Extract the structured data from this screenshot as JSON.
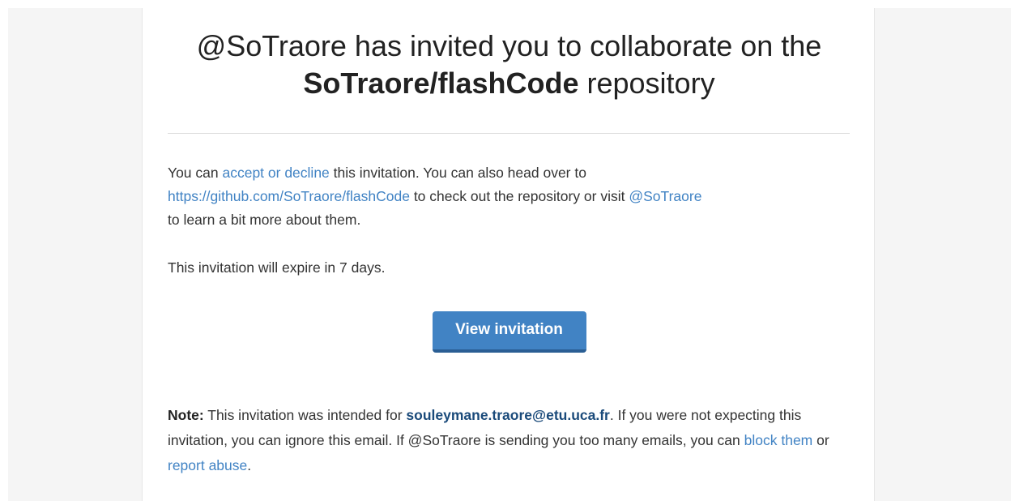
{
  "header": {
    "line1": "@SoTraore has invited you to collaborate on the",
    "repo": "SoTraore/flashCode",
    "repo_suffix": " repository"
  },
  "body": {
    "p1_before_accept": "You can ",
    "accept_link": "accept or decline",
    "p1_after_accept": " this invitation. You can also head over to",
    "repo_url": "https://github.com/SoTraore/flashCode",
    "p1_after_url": " to check out the repository or visit ",
    "user_link": "@SoTraore",
    "p1_end": "to learn a bit more about them.",
    "expiry": "This invitation will expire in 7 days."
  },
  "cta": {
    "label": "View invitation"
  },
  "note": {
    "label": "Note:",
    "before_email": " This invitation was intended for ",
    "email": "souleymane.traore@etu.uca.fr",
    "after_email": ". If you were not expecting this invitation, you can ignore this email. If @SoTraore is sending you too many emails, you can ",
    "block_link": "block them",
    "or_text": " or ",
    "report_link": "report abuse",
    "end": "."
  },
  "colors": {
    "link": "#4183c4",
    "button": "#4183c4",
    "email": "#1a4a7a"
  }
}
